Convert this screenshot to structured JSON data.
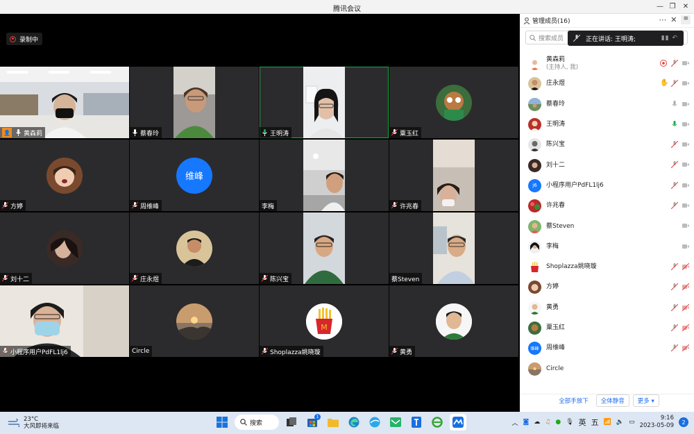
{
  "window": {
    "title": "腾讯会议",
    "min": "—",
    "max": "❐",
    "close": "✕"
  },
  "recording": {
    "label": "录制中"
  },
  "tiles": [
    {
      "name": "黄森莉",
      "host": true
    },
    {
      "name": "蔡春玲"
    },
    {
      "name": "王明涛",
      "speaking": true
    },
    {
      "name": "粟玉红"
    },
    {
      "name": "方婷"
    },
    {
      "name": "周维峰",
      "avatar_text": "维峰"
    },
    {
      "name": "李梅"
    },
    {
      "name": "许兆春"
    },
    {
      "name": "刘十二"
    },
    {
      "name": "庄永煜"
    },
    {
      "name": "陈兴宝"
    },
    {
      "name": "蔡Steven"
    },
    {
      "name": "小程序用户PdFL1lj6"
    },
    {
      "name": "Circle"
    },
    {
      "name": "Shoplazza姚晓璇"
    },
    {
      "name": "黄勇"
    }
  ],
  "panel": {
    "header": "管理成员(16)",
    "search_placeholder": "搜索成员",
    "toast": "正在讲话: 王明涛;",
    "members": [
      {
        "name": "黄森莉",
        "sub": "(主持人, 我)"
      },
      {
        "name": "庄永煜"
      },
      {
        "name": "蔡春玲"
      },
      {
        "name": "王明涛"
      },
      {
        "name": "陈兴宝"
      },
      {
        "name": "刘十二"
      },
      {
        "name": "小程序用户PdFL1lj6",
        "avatar_text": "j6"
      },
      {
        "name": "许兆春"
      },
      {
        "name": "蔡Steven"
      },
      {
        "name": "李梅"
      },
      {
        "name": "Shoplazza姚晓璇"
      },
      {
        "name": "方婷"
      },
      {
        "name": "黄勇"
      },
      {
        "name": "粟玉红"
      },
      {
        "name": "周维峰",
        "avatar_text": "维峰"
      },
      {
        "name": "Circle"
      }
    ],
    "footer": {
      "all_hands_down": "全部手放下",
      "mute_all": "全体静音",
      "more": "更多 ▾"
    }
  },
  "taskbar": {
    "temp": "23°C",
    "weather": "大风即将来临",
    "search": "搜索",
    "lang": "英",
    "ime": "五",
    "time": "9:16",
    "date": "2023-05-09",
    "notif": "2",
    "store_badge": "1"
  },
  "colors": {
    "accent": "#1d6cf0",
    "speaking": "#1ea84a",
    "recording": "#e0413a",
    "hand": "#1d6cf0"
  }
}
